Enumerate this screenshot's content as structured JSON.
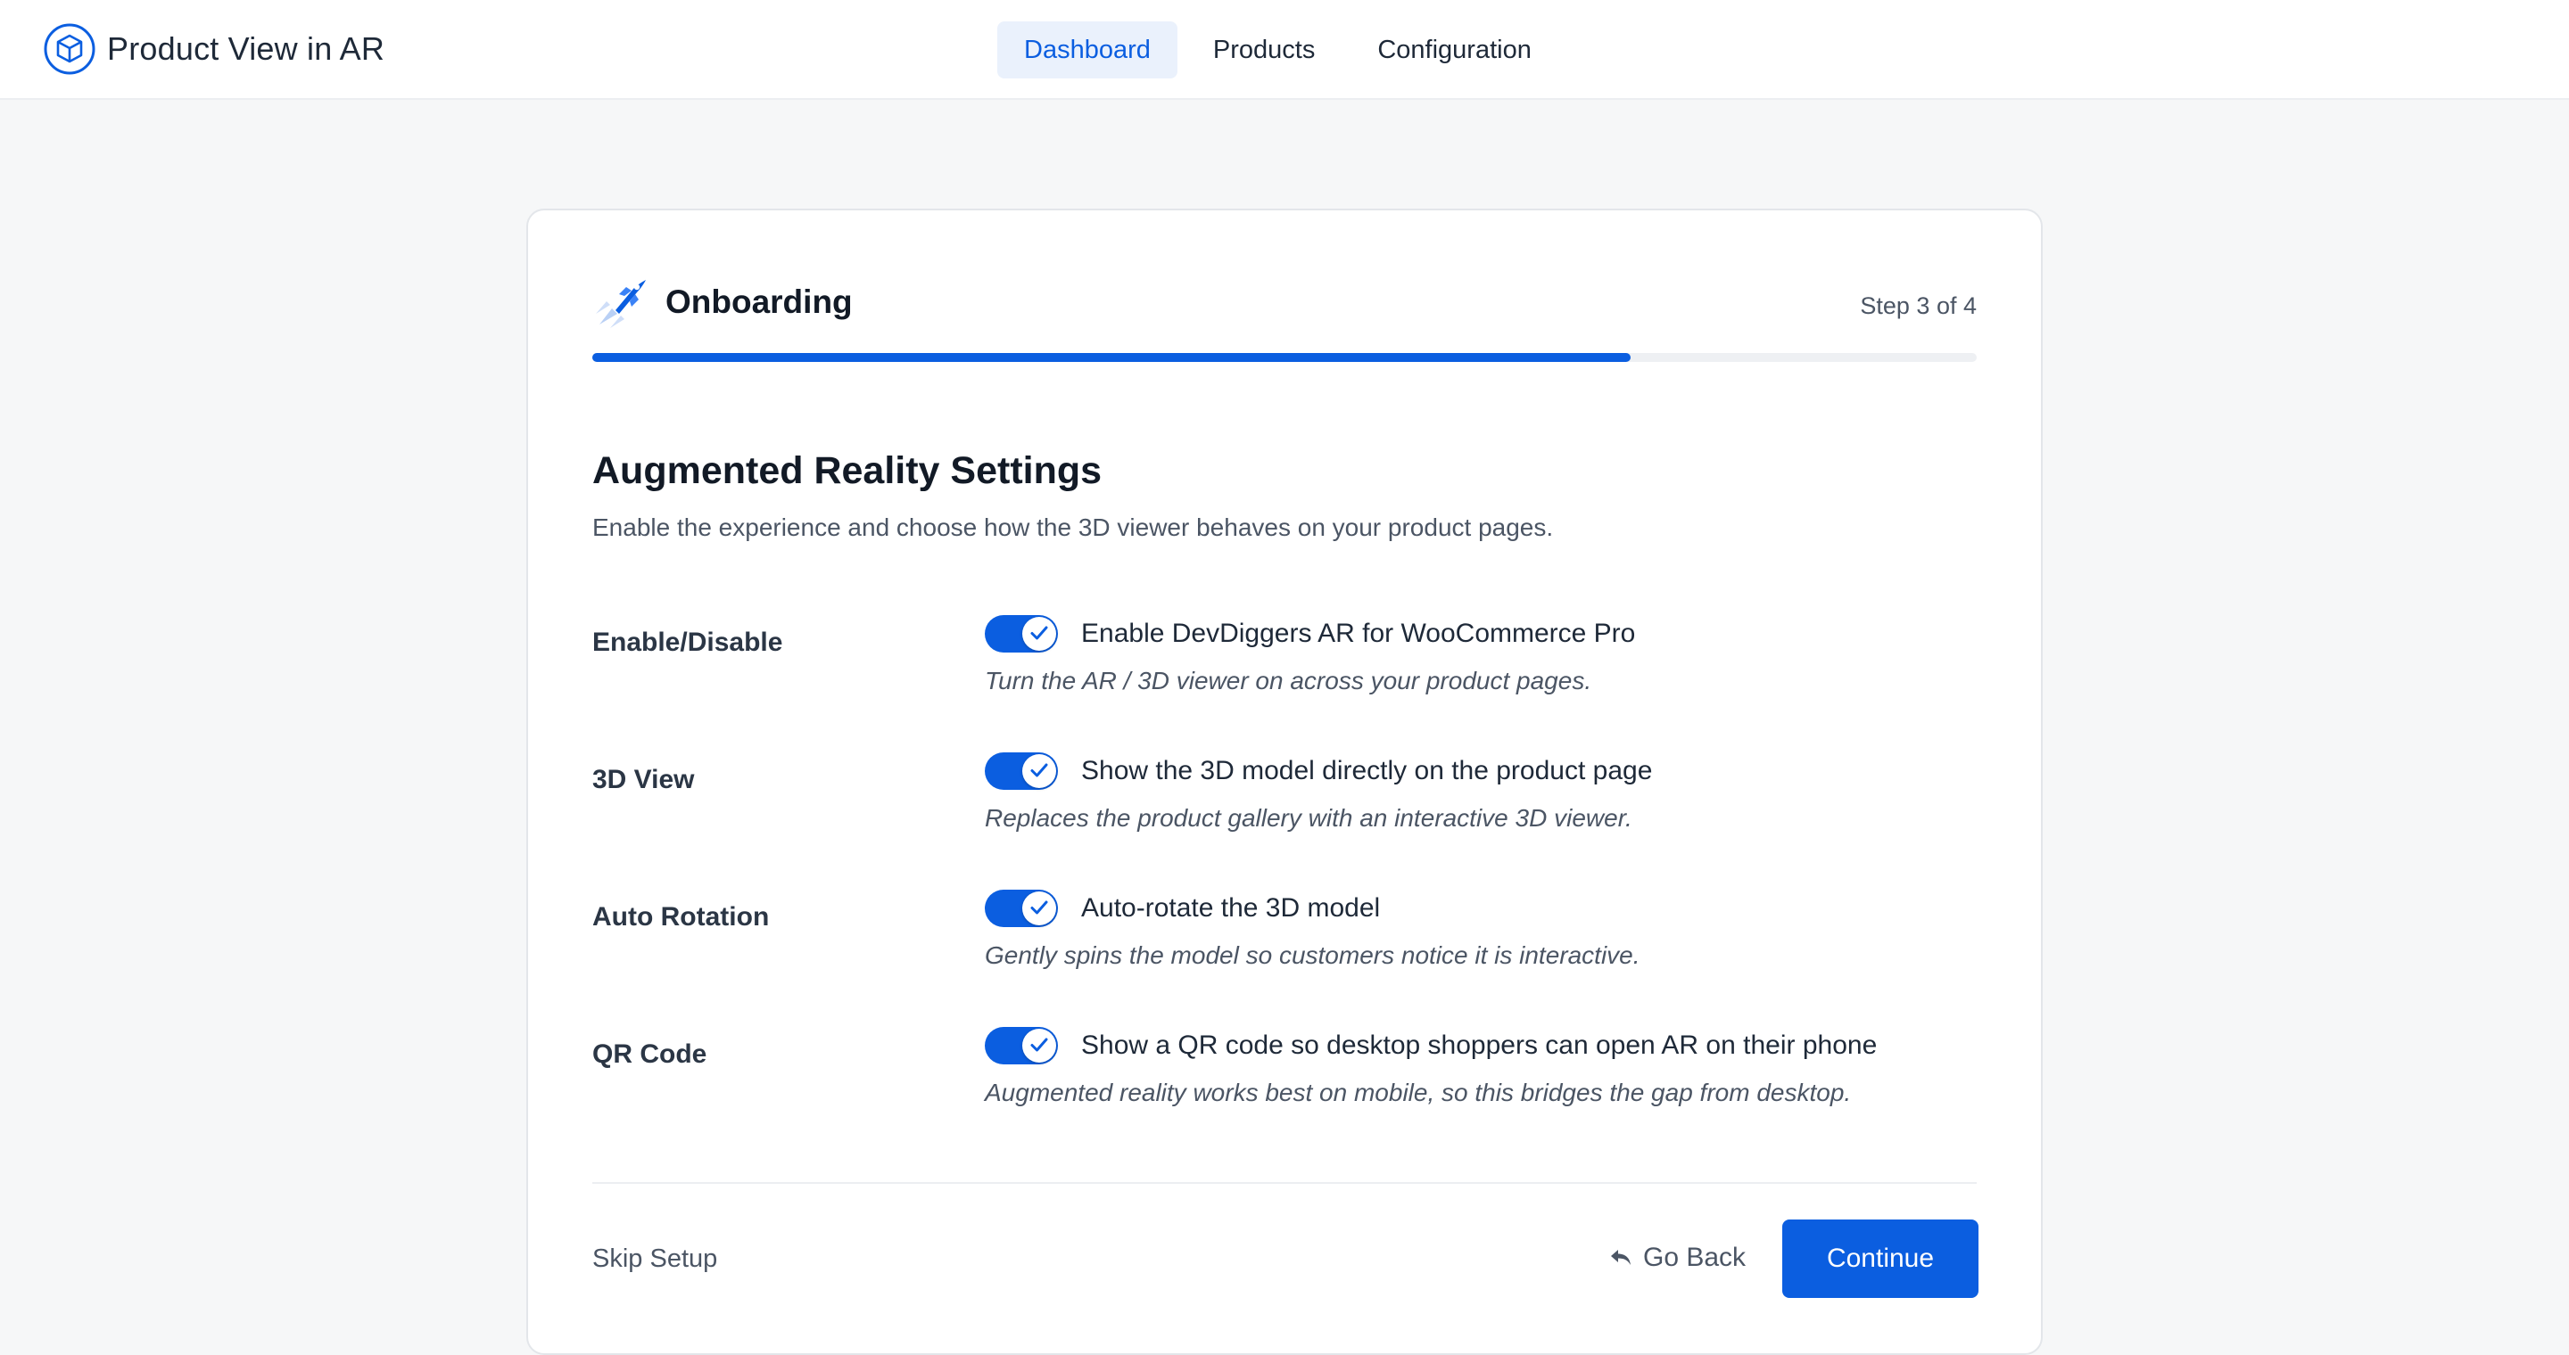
{
  "app": {
    "title": "Product View in AR",
    "logo_icon": "cube-icon"
  },
  "nav": {
    "tabs": [
      {
        "label": "Dashboard",
        "active": true
      },
      {
        "label": "Products",
        "active": false
      },
      {
        "label": "Configuration",
        "active": false
      }
    ]
  },
  "onboarding": {
    "title": "Onboarding",
    "icon": "rocket-icon",
    "step_label": "Step 3 of 4",
    "progress": 0.75
  },
  "section": {
    "title": "Augmented Reality Settings",
    "description": "Enable the experience and choose how the 3D viewer behaves on your product pages."
  },
  "settings": [
    {
      "label": "Enable/Disable",
      "enabled": true,
      "text": "Enable DevDiggers AR for WooCommerce Pro",
      "help": "Turn the AR / 3D viewer on across your product pages."
    },
    {
      "label": "3D View",
      "enabled": true,
      "text": "Show the 3D model directly on the product page",
      "help": "Replaces the product gallery with an interactive 3D viewer."
    },
    {
      "label": "Auto Rotation",
      "enabled": true,
      "text": "Auto-rotate the 3D model",
      "help": "Gently spins the model so customers notice it is interactive."
    },
    {
      "label": "QR Code",
      "enabled": true,
      "text": "Show a QR code so desktop shoppers can open AR on their phone",
      "help": "Augmented reality works best on mobile, so this bridges the gap from desktop."
    }
  ],
  "footer": {
    "skip_label": "Skip Setup",
    "back_label": "Go Back",
    "continue_label": "Continue"
  },
  "colors": {
    "accent": "#0b5ee0",
    "accent_soft": "#eaf1fc",
    "text": "#1e2938",
    "muted": "#4b5564"
  }
}
